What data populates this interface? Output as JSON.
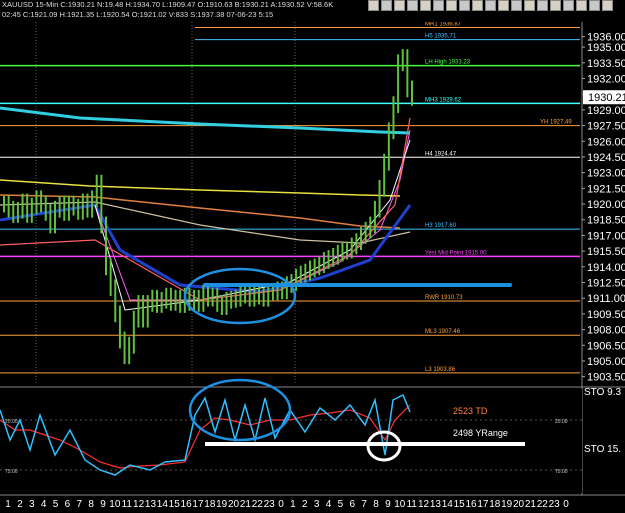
{
  "header": {
    "ohlc_line": "XAUUSD  15-Min  C:1930.21  N:19.48  H:1934.70  L:1909.47  O:1910.63  B:1930.21  A:1930.52  V:58.6K",
    "line2": "02:45  C:1921.09  H:1921.35  L:1920.54  O:1921.02  V:833  S:1937.38  07-06-23  5:15",
    "toolbar_icons": [
      "arrow-icon",
      "cross-icon",
      "line-icon",
      "ray-icon",
      "channel-icon",
      "fib-icon",
      "text-icon",
      "zoom-icon",
      "pan-icon",
      "draw-icon",
      "erase-icon",
      "hline-icon",
      "vline-icon",
      "arrow2-icon",
      "box-icon",
      "ellipse-icon",
      "magnet-icon",
      "settings-icon",
      "close-icon"
    ]
  },
  "chart_data": {
    "type": "line",
    "price_axis": {
      "ticks": [
        1936.0,
        1935.0,
        1933.5,
        1932.0,
        1930.5,
        1929.0,
        1927.5,
        1926.0,
        1924.5,
        1923.0,
        1921.5,
        1920.0,
        1918.5,
        1917.0,
        1915.5,
        1914.0,
        1912.5,
        1911.0,
        1909.5,
        1908.0,
        1906.5,
        1905.0,
        1903.5
      ],
      "tick_labels": [
        "1936.00",
        "1935.00",
        "1933.50",
        "1932.00",
        "1930.50",
        "1929.00",
        "1927.50",
        "1926.00",
        "1924.50",
        "1923.00",
        "1921.50",
        "1920.00",
        "1918.50",
        "1917.00",
        "1915.50",
        "1914.00",
        "1912.50",
        "1911.00",
        "1909.50",
        "1908.00",
        "1906.50",
        "1905.00",
        "1903.50"
      ],
      "last_price": "1930.21",
      "ylim": [
        1902.8,
        1937.4
      ]
    },
    "time_axis": {
      "labels": [
        "1",
        "2",
        "3",
        "4",
        "5",
        "6",
        "7",
        "8",
        "9",
        "10",
        "11",
        "12",
        "13",
        "14",
        "15",
        "16",
        "17",
        "18",
        "19",
        "20",
        "21",
        "22",
        "23",
        "0",
        "1",
        "2",
        "3",
        "4",
        "5",
        "6",
        "7",
        "8",
        "9",
        "10",
        "11",
        "12",
        "13",
        "14",
        "15",
        "16",
        "17",
        "18",
        "19",
        "20",
        "21",
        "22",
        "23",
        "0"
      ]
    },
    "levels": [
      {
        "name": "MR1",
        "label": "MR1 1936.87",
        "value": 1936.87,
        "color": "#ffa040"
      },
      {
        "name": "H5",
        "label": "H5 1935.71",
        "value": 1935.71,
        "color": "#40c0ff"
      },
      {
        "name": "LH High",
        "label": "LH High 1933.23",
        "value": 1933.23,
        "color": "#40ff40"
      },
      {
        "name": "MH3",
        "label": "MH3 1929.62",
        "value": 1929.62,
        "color": "#40ffff"
      },
      {
        "name": "YH",
        "label": "YH 1927.49",
        "value": 1927.49,
        "color": "#ffa040"
      },
      {
        "name": "H4",
        "label": "H4 1924.47",
        "value": 1924.47,
        "color": "#ffffff"
      },
      {
        "name": "H3",
        "label": "H3 1917.60",
        "value": 1917.6,
        "color": "#40c0ff"
      },
      {
        "name": "Yest Mid Point",
        "label": "Yest Mid Point 1915.00",
        "value": 1915.0,
        "color": "#ff40ff"
      },
      {
        "name": "RWR",
        "label": "RWR 1910.73",
        "value": 1910.73,
        "color": "#ffa040"
      },
      {
        "name": "ML3",
        "label": "ML3 1907.46",
        "value": 1907.46,
        "color": "#ffa040"
      },
      {
        "name": "L3",
        "label": "L3 1903.86",
        "value": 1903.86,
        "color": "#ffa040"
      }
    ],
    "price_series": [
      1920.0,
      1919.5,
      1919.0,
      1919.4,
      1920.2,
      1919.0,
      1919.8,
      1920.5,
      1920.0,
      1919.2,
      1918.0,
      1919.5,
      1920.0,
      1919.2,
      1920.0,
      1919.7,
      1919.3,
      1920.2,
      1919.5,
      1920.5,
      1922.0,
      1918.0,
      1914.0,
      1912.0,
      1909.5,
      1907.0,
      1905.5,
      1906.5,
      1909.0,
      1910.5,
      1909.0,
      1910.5,
      1911.0,
      1910.4,
      1910.8,
      1911.2,
      1910.6,
      1911.0,
      1910.4,
      1911.2,
      1910.6,
      1911.0,
      1910.5,
      1911.5,
      1911.0,
      1911.2,
      1910.5,
      1910.2,
      1910.8,
      1910.9,
      1911.0,
      1911.5,
      1911.3,
      1911.0,
      1911.4,
      1911.2,
      1911.0,
      1911.6,
      1911.6,
      1911.8,
      1911.7,
      1912.3,
      1912.5,
      1913.0,
      1913.3,
      1913.5,
      1913.8,
      1914.0,
      1914.2,
      1914.6,
      1914.8,
      1915.0,
      1915.3,
      1915.5,
      1915.6,
      1916.0,
      1916.4,
      1917.0,
      1917.5,
      1918.0,
      1919.5,
      1921.5,
      1924.0,
      1927.0,
      1929.5,
      1933.5,
      1934.0,
      1931.0,
      1930.2
    ],
    "stochastic": {
      "label": "STO",
      "axis_labels": [
        "25.00",
        "75.00"
      ],
      "annotations": [
        "2523 TD",
        "2498 YRange"
      ],
      "right_labels": [
        "STO  9.3",
        "STO  15."
      ]
    }
  }
}
